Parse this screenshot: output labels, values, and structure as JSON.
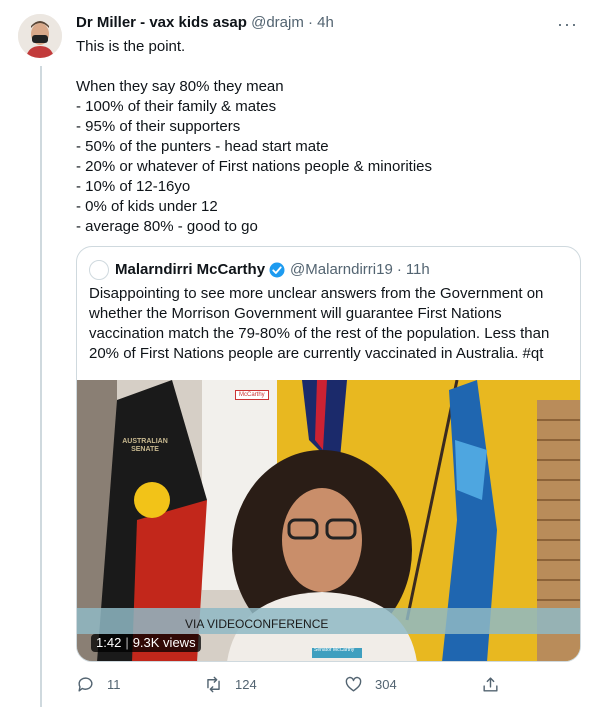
{
  "tweet": {
    "display_name": "Dr Miller - vax kids asap",
    "handle": "@drajm",
    "separator": "·",
    "time": "4h",
    "more_label": "···",
    "text": "This is the point.\n\nWhen they say 80% they mean\n- 100% of their family & mates\n- 95% of their supporters\n- 50% of the punters - head start mate\n- 20% or whatever of First nations people & minorities\n- 10% of 12-16yo\n- 0% of kids under 12\n- average 80% - good to go"
  },
  "quoted": {
    "display_name": "Malarndirri McCarthy",
    "handle": "@Malarndirri19",
    "separator": "·",
    "time": "11h",
    "text": "Disappointing to see more unclear answers from the Government on whether the Morrison Government will guarantee First Nations vaccination match the 79-80% of the rest of the population. Less than 20% of First Nations people are currently vaccinated in Australia. #qt",
    "video": {
      "duration": "1:42",
      "views": "9.3K views",
      "caption": "VIA VIDEOCONFERENCE",
      "nameplate": "Senator McCarthy",
      "sign_text": "AUSTRALIAN SENATE",
      "paper_text": "McCarthy"
    }
  },
  "actions": {
    "reply_count": "11",
    "retweet_count": "124",
    "like_count": "304"
  },
  "colors": {
    "accent": "#1d9bf0",
    "muted": "#536471",
    "border": "#cfd9de"
  }
}
